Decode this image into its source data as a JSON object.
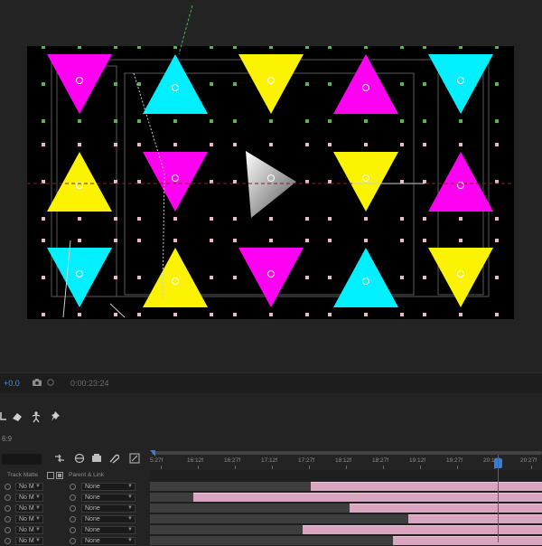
{
  "viewer": {
    "colors": {
      "cyan": "#00f0ff",
      "yellow": "#fbf300",
      "magenta": "#ff00f2",
      "handle_green": "#54b74c",
      "handle_pink": "#e9b9c9"
    },
    "grid": [
      {
        "row": 0,
        "shapes": [
          {
            "color": "magenta",
            "dir": "down"
          },
          {
            "color": "cyan",
            "dir": "up"
          },
          {
            "color": "yellow",
            "dir": "down"
          },
          {
            "color": "magenta",
            "dir": "up"
          },
          {
            "color": "cyan",
            "dir": "down"
          }
        ]
      },
      {
        "row": 1,
        "shapes": [
          {
            "color": "yellow",
            "dir": "up"
          },
          {
            "color": "magenta",
            "dir": "down"
          },
          {
            "color": "white",
            "dir": "right"
          },
          {
            "color": "yellow",
            "dir": "down"
          },
          {
            "color": "magenta",
            "dir": "up"
          }
        ]
      },
      {
        "row": 2,
        "shapes": [
          {
            "color": "cyan",
            "dir": "down"
          },
          {
            "color": "yellow",
            "dir": "up"
          },
          {
            "color": "magenta",
            "dir": "down"
          },
          {
            "color": "cyan",
            "dir": "up"
          },
          {
            "color": "yellow",
            "dir": "down"
          }
        ]
      }
    ]
  },
  "status": {
    "zoom": "+0.0",
    "timecode": "0:00:23:24",
    "camera_icon": "camera-icon"
  },
  "toolbar": {
    "icons": [
      "pen-icon",
      "eraser-icon",
      "puppet-icon",
      "pin-icon"
    ]
  },
  "timeline": {
    "ratio_label": "6:9",
    "columns": {
      "track_matte": "Track Matte",
      "parent_link": "Parent & Link"
    },
    "rows": [
      {
        "matte": "No M",
        "parent": "None"
      },
      {
        "matte": "No M",
        "parent": "None"
      },
      {
        "matte": "No M",
        "parent": "None"
      },
      {
        "matte": "No M",
        "parent": "None"
      },
      {
        "matte": "No M",
        "parent": "None"
      },
      {
        "matte": "No M",
        "parent": "None"
      }
    ],
    "ruler": [
      "5:27f",
      "16:12f",
      "16:27f",
      "17:12f",
      "17:27f",
      "18:12f",
      "18:27f",
      "19:12f",
      "19:27f",
      "20:12f",
      "20:27f"
    ],
    "current_time_fraction": 0.88
  }
}
